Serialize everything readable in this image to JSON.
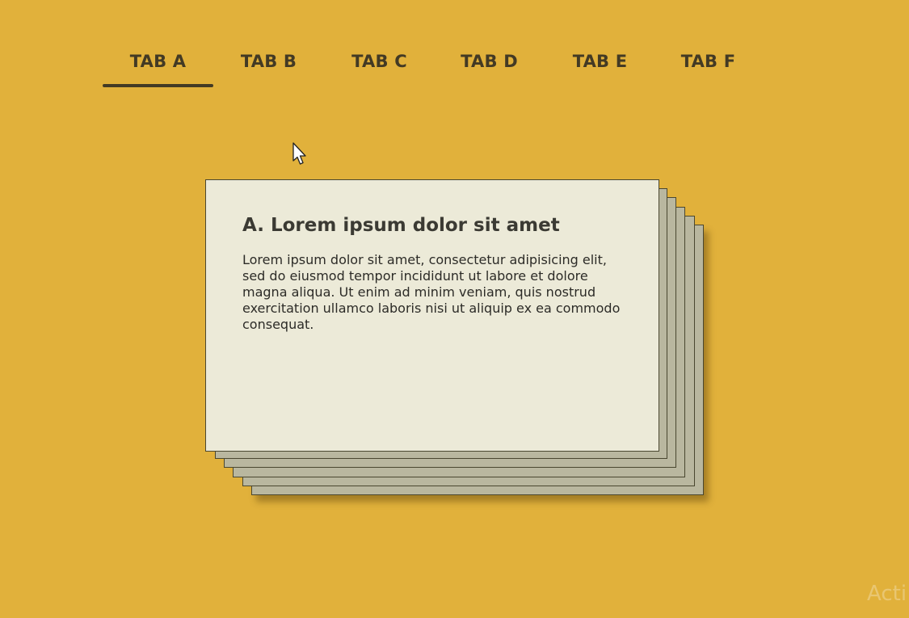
{
  "tabs": [
    {
      "label": "TAB A",
      "active": true
    },
    {
      "label": "TAB B",
      "active": false
    },
    {
      "label": "TAB C",
      "active": false
    },
    {
      "label": "TAB D",
      "active": false
    },
    {
      "label": "TAB E",
      "active": false
    },
    {
      "label": "TAB F",
      "active": false
    }
  ],
  "panel": {
    "title": "A. Lorem ipsum dolor sit amet",
    "body": "Lorem ipsum dolor sit amet, consectetur adipisicing elit, sed do eiusmod tempor incididunt ut labore et dolore magna aliqua. Ut enim ad minim veniam, quis nostrud exercitation ullamco laboris nisi ut aliquip ex ea commodo consequat."
  },
  "watermark": "Acti",
  "colors": {
    "background": "#E1B13B",
    "tab_text": "#433A24",
    "card_face": "#ECEAD8",
    "card_stack": "#B9B79F"
  },
  "icons": {
    "cursor": "mouse-pointer-icon"
  }
}
